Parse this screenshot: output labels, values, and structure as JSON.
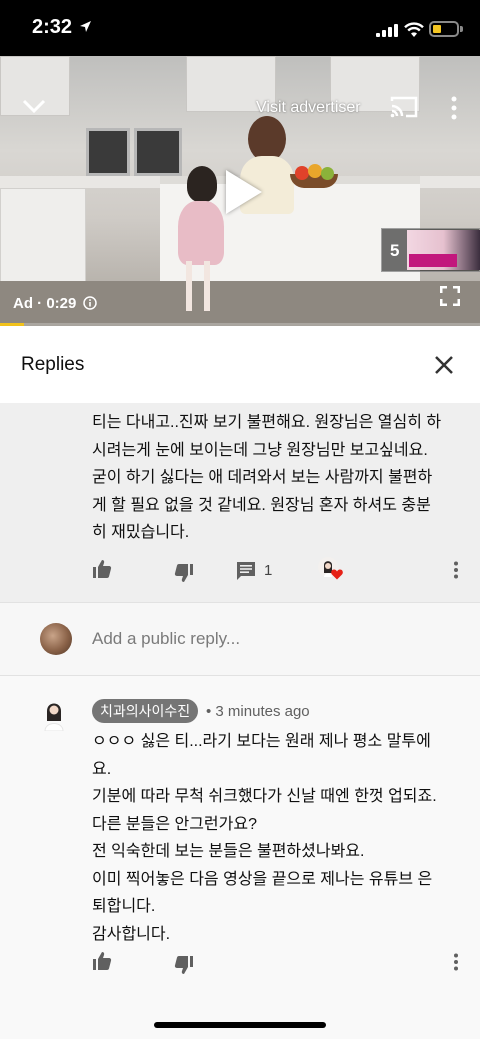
{
  "status_bar": {
    "time": "2:32"
  },
  "video": {
    "visit_advertiser": "Visit advertiser",
    "ad_label": "Ad · 0:29",
    "skip_count": "5",
    "progress_fraction": 0.05
  },
  "replies_panel": {
    "title": "Replies"
  },
  "parent_comment": {
    "lines": [
      "티는 다내고..진짜 보기 불편해요. 원장님은 열심히 하",
      "시려는게 눈에 보이는데 그냥 원장님만 보고싶네요.",
      "굳이 하기 싫다는 애 데려와서 보는 사람까지 불편하",
      "게 할 필요 없을 것 같네요. 원장님 혼자 하셔도 충분",
      "히 재밌습니다."
    ],
    "reply_count": "1"
  },
  "reply_input": {
    "placeholder": "Add a public reply..."
  },
  "reply": {
    "author": "치과의사이수진",
    "time": "• 3 minutes ago",
    "lines": [
      "ㅇㅇㅇ 싫은 티...라기 보다는 원래 제나 평소 말투에",
      "요.",
      "기분에 따라 무척 쉬크했다가 신날 때엔 한껏 업되죠.",
      "다른 분들은 안그런가요?",
      "전 익숙한데 보는 분들은 불편하셨나봐요.",
      "이미 찍어놓은 다음 영상을 끝으로 제나는 유튜브 은",
      "퇴합니다.",
      "감사합니다."
    ]
  },
  "colors": {
    "accent_yellow": "#f2c21b",
    "heart_red": "#e62117",
    "chip_gray": "#757575"
  },
  "icons": [
    "location-arrow-icon",
    "signal-icon",
    "wifi-icon",
    "battery-icon",
    "chevron-down-icon",
    "cast-icon",
    "more-vert-icon",
    "play-icon",
    "info-icon",
    "fullscreen-icon",
    "close-icon",
    "thumb-up-icon",
    "thumb-down-icon",
    "comment-icon",
    "heart-icon"
  ]
}
